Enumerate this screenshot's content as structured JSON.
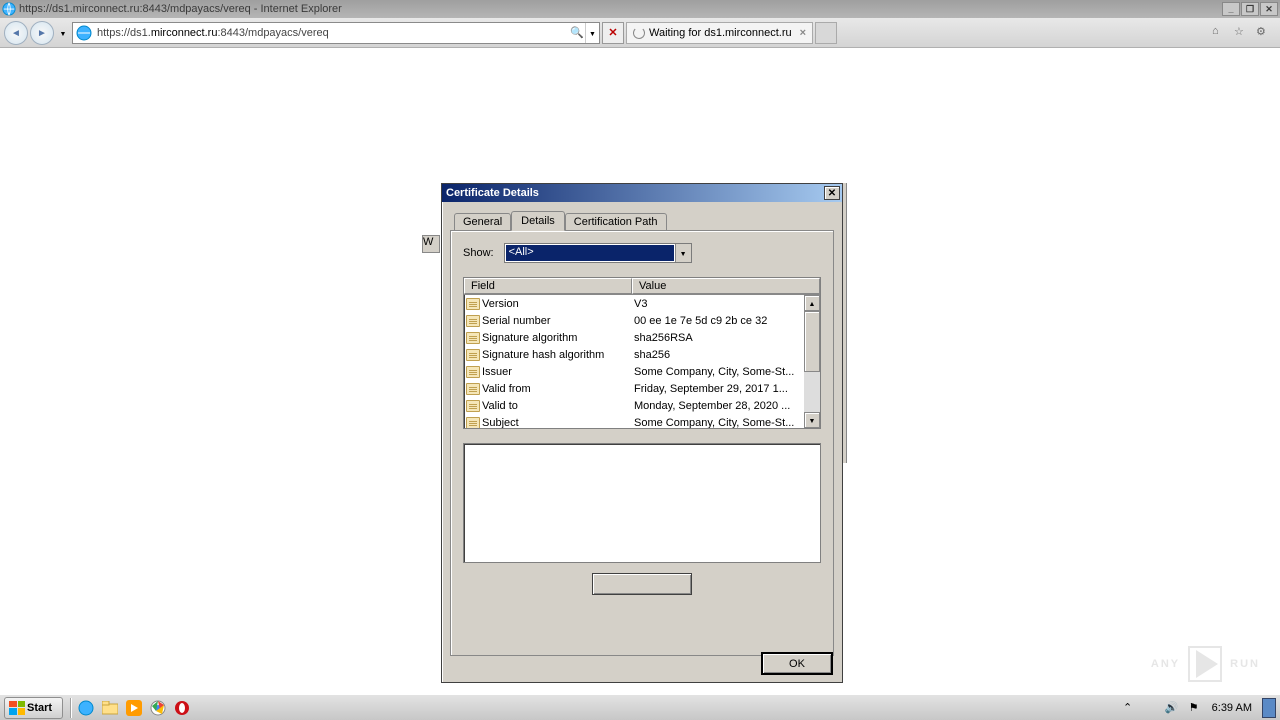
{
  "ie": {
    "title": "https://ds1.mirconnect.ru:8443/mdpayacs/vereq - Internet Explorer",
    "url_prefix": "https://ds1.",
    "url_host": "mirconnect.ru",
    "url_suffix": ":8443/mdpayacs/vereq",
    "tab_text": "Waiting for ds1.mirconnect.ru"
  },
  "dialog": {
    "title": "Certificate Details",
    "tabs": {
      "general": "General",
      "details": "Details",
      "path": "Certification Path"
    },
    "show_label": "Show:",
    "show_value": "<All>",
    "col_field": "Field",
    "col_value": "Value",
    "ok": "OK",
    "rows": [
      {
        "f": "Version",
        "v": "V3"
      },
      {
        "f": "Serial number",
        "v": "00 ee 1e 7e 5d c9 2b ce 32"
      },
      {
        "f": "Signature algorithm",
        "v": "sha256RSA"
      },
      {
        "f": "Signature hash algorithm",
        "v": "sha256"
      },
      {
        "f": "Issuer",
        "v": "Some Company, City, Some-St..."
      },
      {
        "f": "Valid from",
        "v": "Friday, ‎September ‎29, ‎2017 1..."
      },
      {
        "f": "Valid to",
        "v": "Monday, September 28, 2020 ..."
      },
      {
        "f": "Subject",
        "v": "Some Company, City, Some-St..."
      }
    ]
  },
  "taskbar": {
    "start": "Start",
    "clock": "6:39 AM"
  },
  "watermark": {
    "a": "ANY",
    "b": "RUN"
  }
}
